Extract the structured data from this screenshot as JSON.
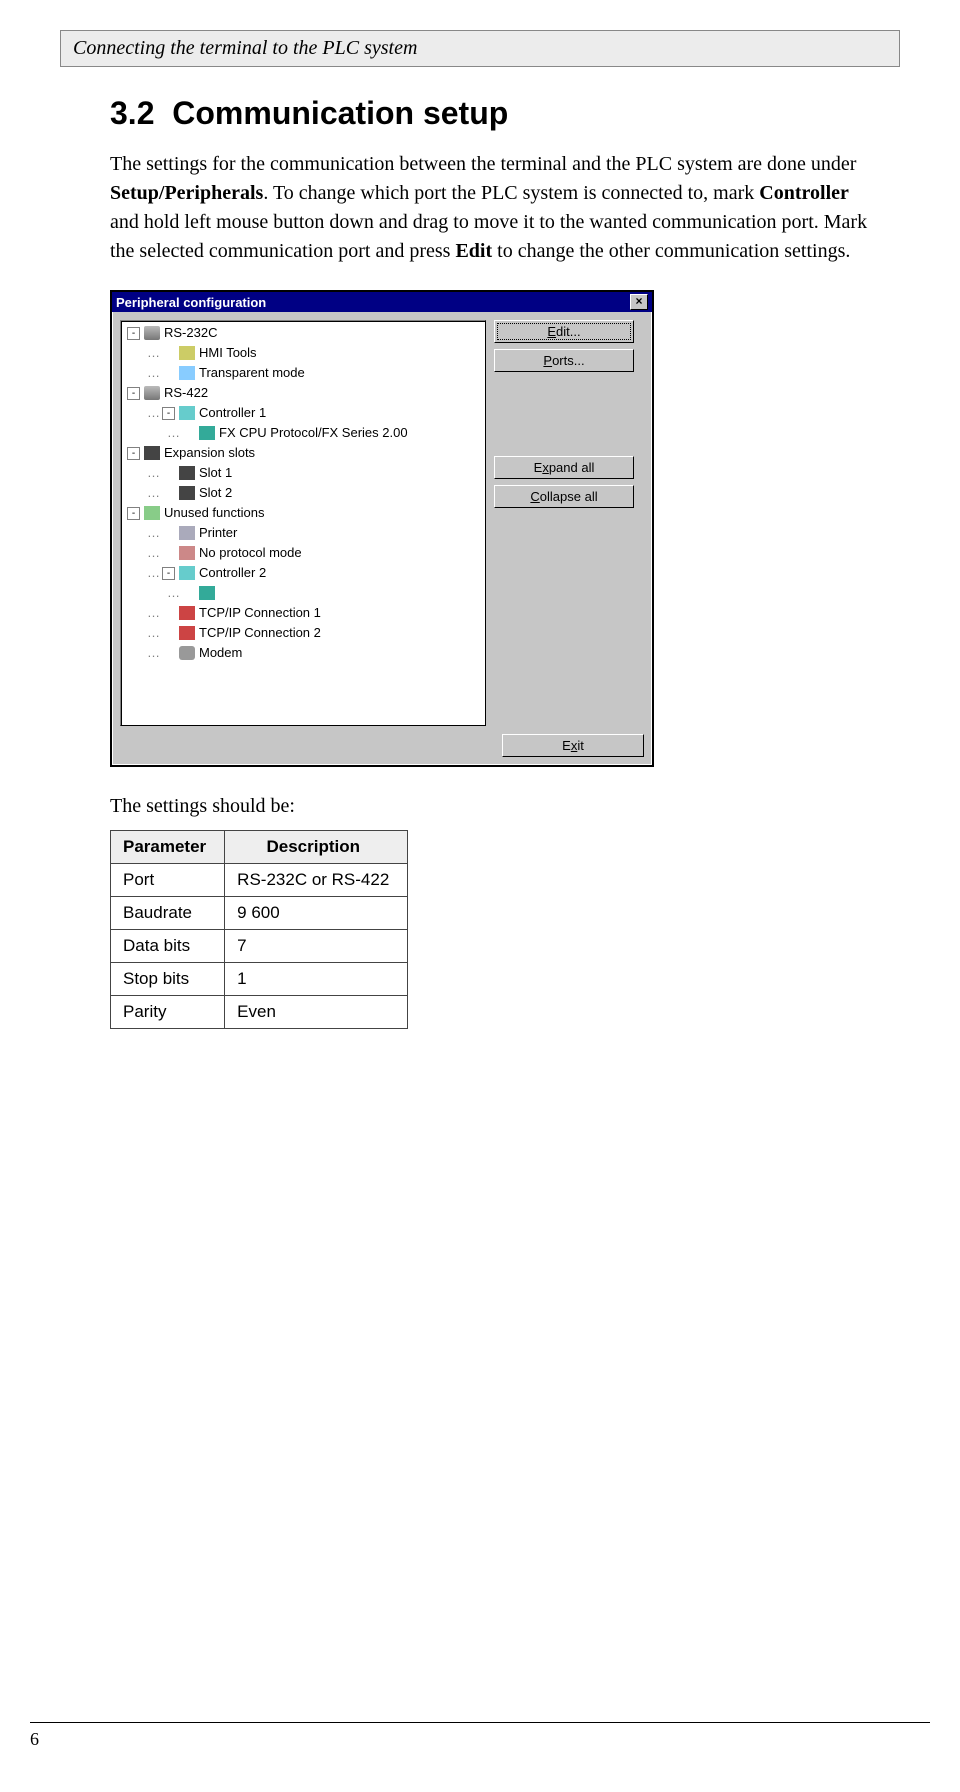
{
  "running_head": "Connecting the terminal to the PLC system",
  "section_number": "3.2",
  "section_title": "Communication setup",
  "para1_a": "The settings for the communication between the terminal and the PLC system are done under ",
  "para1_b": "Setup/Peripherals",
  "para1_c": ". To change which port the PLC system is connected to, mark ",
  "para1_d": "Controller",
  "para1_e": " and hold left mouse button down and drag to move it to the wanted communication port. Mark the selected communication port and press ",
  "para1_f": "Edit",
  "para1_g": " to change the other communication settings.",
  "dialog": {
    "title": "Peripheral configuration",
    "buttons": {
      "edit": {
        "pre": "",
        "u": "E",
        "post": "dit..."
      },
      "ports": {
        "pre": "",
        "u": "P",
        "post": "orts..."
      },
      "expand": {
        "pre": "E",
        "u": "x",
        "post": "pand all"
      },
      "collapse": {
        "pre": "",
        "u": "C",
        "post": "ollapse all"
      },
      "exit": {
        "pre": "E",
        "u": "x",
        "post": "it"
      }
    },
    "tree": [
      {
        "d": 0,
        "exp": "-",
        "ico": "port",
        "label": "RS-232C"
      },
      {
        "d": 1,
        "exp": "",
        "ico": "tool",
        "label": "HMI Tools"
      },
      {
        "d": 1,
        "exp": "",
        "ico": "tp",
        "label": "Transparent mode"
      },
      {
        "d": 0,
        "exp": "-",
        "ico": "port",
        "label": "RS-422"
      },
      {
        "d": 1,
        "exp": "-",
        "ico": "ctrl",
        "label": "Controller 1"
      },
      {
        "d": 2,
        "exp": "",
        "ico": "chip",
        "label": "FX CPU Protocol/FX Series 2.00"
      },
      {
        "d": 0,
        "exp": "-",
        "ico": "slot",
        "label": "Expansion slots"
      },
      {
        "d": 1,
        "exp": "",
        "ico": "slot",
        "label": "Slot 1"
      },
      {
        "d": 1,
        "exp": "",
        "ico": "slot",
        "label": "Slot 2"
      },
      {
        "d": 0,
        "exp": "-",
        "ico": "bucket",
        "label": "Unused functions"
      },
      {
        "d": 1,
        "exp": "",
        "ico": "printer",
        "label": "Printer"
      },
      {
        "d": 1,
        "exp": "",
        "ico": "np",
        "label": "No protocol mode"
      },
      {
        "d": 1,
        "exp": "-",
        "ico": "ctrl",
        "label": "Controller 2"
      },
      {
        "d": 2,
        "exp": "",
        "ico": "chip",
        "label": ""
      },
      {
        "d": 1,
        "exp": "",
        "ico": "tcp",
        "label": "TCP/IP Connection 1"
      },
      {
        "d": 1,
        "exp": "",
        "ico": "tcp",
        "label": "TCP/IP Connection 2"
      },
      {
        "d": 1,
        "exp": "",
        "ico": "modem",
        "label": "Modem"
      }
    ]
  },
  "lead": "The settings should be:",
  "table": {
    "head": [
      "Parameter",
      "Description"
    ],
    "rows": [
      [
        "Port",
        "RS-232C or RS-422"
      ],
      [
        "Baudrate",
        "9 600"
      ],
      [
        "Data bits",
        "7"
      ],
      [
        "Stop bits",
        "1"
      ],
      [
        "Parity",
        "Even"
      ]
    ]
  },
  "page_number": "6"
}
